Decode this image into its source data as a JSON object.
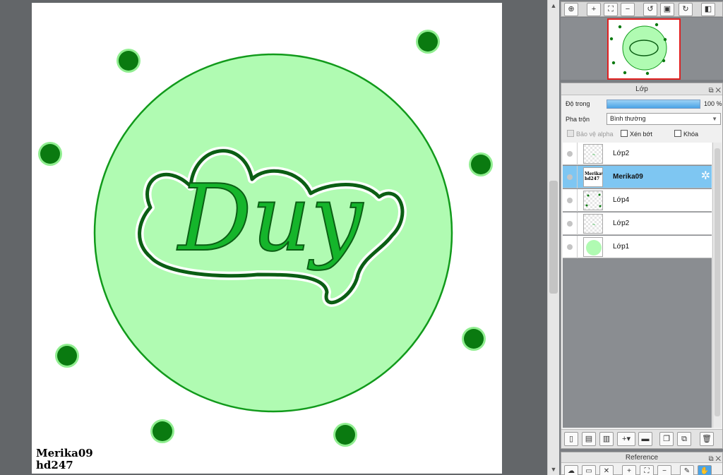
{
  "canvas": {
    "signature_line1": "Merika09",
    "signature_line2": "hd247",
    "artwork_text": "Duy",
    "colors": {
      "paper": "#ffffff",
      "circle_fill": "#b0fbb2",
      "circle_stroke": "#119a1b",
      "dot": "#0a7a10",
      "dot_halo": "#90ee90",
      "outline": "#0b5e14",
      "letters": "#15b52b"
    }
  },
  "navigator_toolbar": {
    "buttons": [
      "zoom-fit-icon",
      "zoom-in-icon",
      "fit-screen-icon",
      "zoom-out-icon",
      "rotate-left-icon",
      "actual-size-icon",
      "rotate-right-icon",
      "flip-icon"
    ]
  },
  "layer_panel": {
    "title": "Lớp",
    "opacity_label": "Độ trong",
    "opacity_value": "100 %",
    "opacity_fraction": 1.0,
    "blend_label": "Pha trộn",
    "blend_value": "Bình thường",
    "protect_alpha_label": "Bảo vệ alpha",
    "clipping_label": "Xén bớt",
    "lock_label": "Khóa",
    "layers": [
      {
        "name": "Lớp2",
        "selected": false,
        "thumb": "text"
      },
      {
        "name": "Merika09",
        "selected": true,
        "thumb": "signature",
        "thumb_text": "Merika09\nhd247"
      },
      {
        "name": "Lớp4",
        "selected": false,
        "thumb": "dots"
      },
      {
        "name": "Lớp2",
        "selected": false,
        "thumb": "text"
      },
      {
        "name": "Lớp1",
        "selected": false,
        "thumb": "circle"
      }
    ],
    "toolbar": [
      "new-layer-icon",
      "new-raster-icon",
      "new-1bit-icon",
      "new-special-icon",
      "folder-icon",
      "duplicate-icon",
      "merge-icon",
      "delete-icon"
    ]
  },
  "reference_panel": {
    "title": "Reference"
  }
}
